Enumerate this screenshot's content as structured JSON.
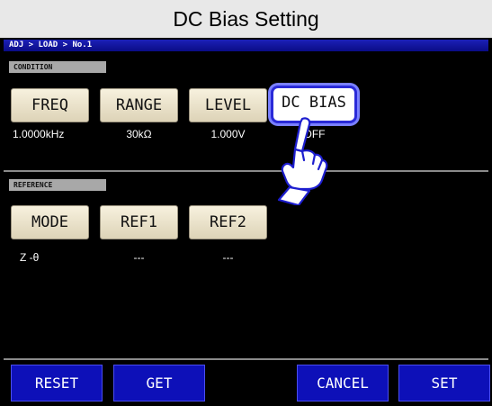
{
  "title": "DC Bias Setting",
  "breadcrumb": "ADJ > LOAD > No.1",
  "condition": {
    "tag": "CONDITION",
    "buttons": [
      "FREQ",
      "RANGE",
      "LEVEL",
      "DC BIAS"
    ],
    "values": [
      "1.0000kHz",
      "30kΩ",
      "1.000V",
      "OFF"
    ]
  },
  "reference": {
    "tag": "REFERENCE",
    "buttons": [
      "MODE",
      "REF1",
      "REF2"
    ],
    "values": [
      "Z -θ",
      "---",
      "---"
    ]
  },
  "bottom": {
    "reset": "RESET",
    "get": "GET",
    "cancel": "CANCEL",
    "set": "SET"
  },
  "colors": {
    "screen": "#000000",
    "breadcrumb": "#1c20b8",
    "button": "#f2ead4",
    "bottom_button": "#0d10b8",
    "highlight": "#2a2ad8"
  },
  "icons": {
    "pointer": "hand-pointer-icon"
  }
}
